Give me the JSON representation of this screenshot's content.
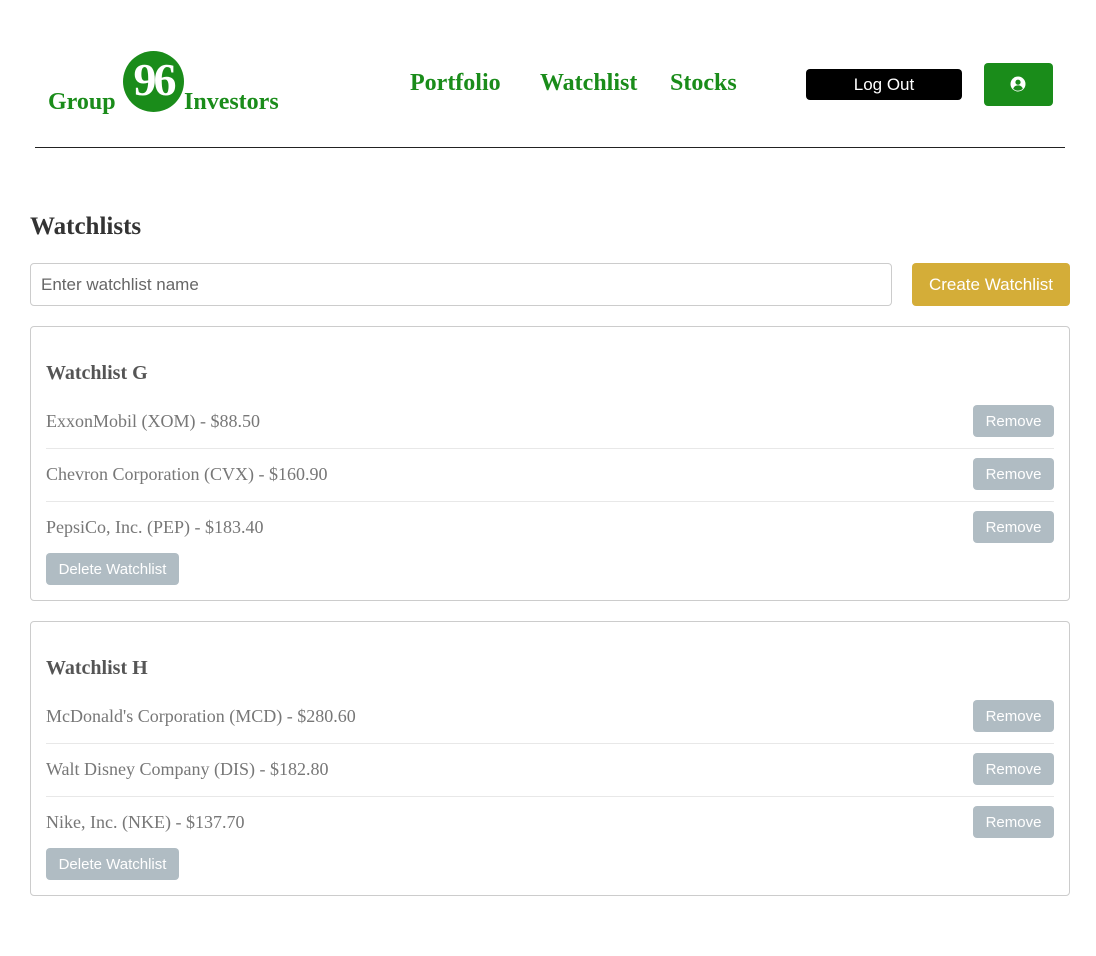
{
  "brand": {
    "word_left": "Group",
    "badge": "96",
    "word_right": "Investors",
    "color": "#1a8c1a"
  },
  "nav": {
    "portfolio": "Portfolio",
    "watchlist": "Watchlist",
    "stocks": "Stocks"
  },
  "header": {
    "logout_label": "Log Out",
    "profile_icon": "user-circle-icon"
  },
  "page": {
    "title": "Watchlists"
  },
  "create": {
    "placeholder": "Enter watchlist name",
    "value": "",
    "button_label": "Create Watchlist",
    "button_color": "#d4ad38"
  },
  "watchlists": [
    {
      "name": "Watchlist G",
      "items": [
        {
          "text": "ExxonMobil (XOM) - $88.50",
          "action": "Remove"
        },
        {
          "text": "Chevron Corporation (CVX) - $160.90",
          "action": "Remove"
        },
        {
          "text": "PepsiCo, Inc. (PEP) - $183.40",
          "action": "Remove"
        }
      ],
      "delete_label": "Delete Watchlist"
    },
    {
      "name": "Watchlist H",
      "items": [
        {
          "text": "McDonald's Corporation (MCD) - $280.60",
          "action": "Remove"
        },
        {
          "text": "Walt Disney Company (DIS) - $182.80",
          "action": "Remove"
        },
        {
          "text": "Nike, Inc. (NKE) - $137.70",
          "action": "Remove"
        }
      ],
      "delete_label": "Delete Watchlist"
    }
  ]
}
